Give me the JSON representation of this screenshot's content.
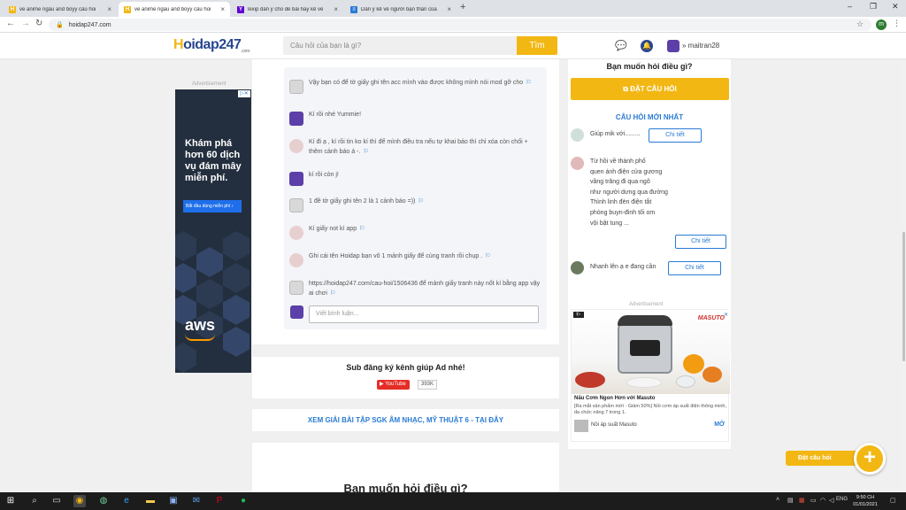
{
  "browser": {
    "tabs": [
      {
        "title": "vẽ anime ngầu and boyy câu hỏi",
        "favicon": "H",
        "active": false
      },
      {
        "title": "vẽ anime ngầu and boyy câu hỏi",
        "favicon": "H",
        "active": true
      },
      {
        "title": "lexip dàn ý cho đề bài hãy kể về",
        "favicon": "Y",
        "active": false
      },
      {
        "title": "Dàn ý kể về người bạn thân của",
        "favicon": "≡",
        "active": false
      }
    ],
    "url": "hoidap247.com",
    "profile_initial": "m"
  },
  "site": {
    "logo_h": "H",
    "logo_rest": "oidap247",
    "logo_sub": ".com",
    "search_placeholder": "Câu hỏi của bạn là gì?",
    "search_button": "Tìm",
    "username": "maitran28"
  },
  "left_ad": {
    "label": "Advertisement",
    "headline": "Khám phá hơn 60 dịch vụ đám mây miễn phí.",
    "cta": "Bắt đầu dùng miễn phí ›",
    "logo": "aws"
  },
  "comments": [
    {
      "avatar": "gray",
      "text": "Vậy bạn có để tờ giấy ghi tên acc mình vào được không mình nói mod gỡ cho"
    },
    {
      "avatar": "purple",
      "text": "Kí rồi nhé Yummie!"
    },
    {
      "avatar": "pink",
      "text": "Kí đi ạ , kí rồi tin ko kí thì để mình điều tra nếu tự khai báo thì chỉ xóa còn chối + thêm cảnh báo á -."
    },
    {
      "avatar": "purple",
      "text": "kí rồi còn j!"
    },
    {
      "avatar": "gray",
      "text": "1 đề tờ giấy ghi tên 2 là 1 cảnh báo =))"
    },
    {
      "avatar": "pink",
      "text": "Kí giấy not kí app"
    },
    {
      "avatar": "pink",
      "text": "Ghi cái tên Hoidap bạn vô 1 mảnh giấy để cùng tranh rồi chụp ."
    },
    {
      "avatar": "gray",
      "text": "https://hoidap247.com/cau-hoi/1506436 để mảnh giấy tranh này nốt kí bằng app vậy ai chơi"
    }
  ],
  "reply_placeholder": "Viết bình luận...",
  "sub_card": {
    "title": "Sub đăng ký kênh giúp Ad nhé!",
    "yt_label": "YouTube",
    "yt_count": "393K"
  },
  "sgk_link": "XEM GIẢI BÀI TẬP SGK ÂM NHẠC, MỸ THUẬT 6 - TẠI ĐÂY",
  "ask_section_title": "Bạn muốn hỏi điều gì?",
  "right": {
    "title": "Bạn muốn hỏi điều gì?",
    "ask_button": "ĐẶT CÂU HỎI",
    "new_questions_title": "CÂU HỎI MỚI NHẤT",
    "questions": [
      {
        "text": "Giúp mik với.........",
        "detail": "Chi tiết"
      },
      {
        "text": "Từ hồi về thành phố\nquen ánh điện cửa gương\nvầng trăng đi qua ngõ\nnhư người dưng qua đường\nThình linh đèn điện tắt\nphòng buyn-đinh tối om\nvội bật tung ...",
        "detail": "Chi tiết"
      },
      {
        "text": "Nhanh lên ạ e đang cần",
        "detail": "Chi tiết"
      }
    ],
    "ad_label": "Advertisement"
  },
  "masuto_ad": {
    "brand": "MASUTO",
    "title": "Nấu Cơm Ngon Hơn với Masuto",
    "desc": "[Ra mắt sản phẩm mới · Giảm 50%] Nồi cơm áp suất điện thông minh, đa chức năng 7 trong 1.",
    "footer": "Nồi áp suất Masuto",
    "open": "MỞ"
  },
  "float_ask": {
    "label": "Đặt câu hỏi",
    "plus": "+"
  },
  "taskbar": {
    "time": "9:50 CH",
    "date": "01/01/2021",
    "lang": "ENG"
  }
}
